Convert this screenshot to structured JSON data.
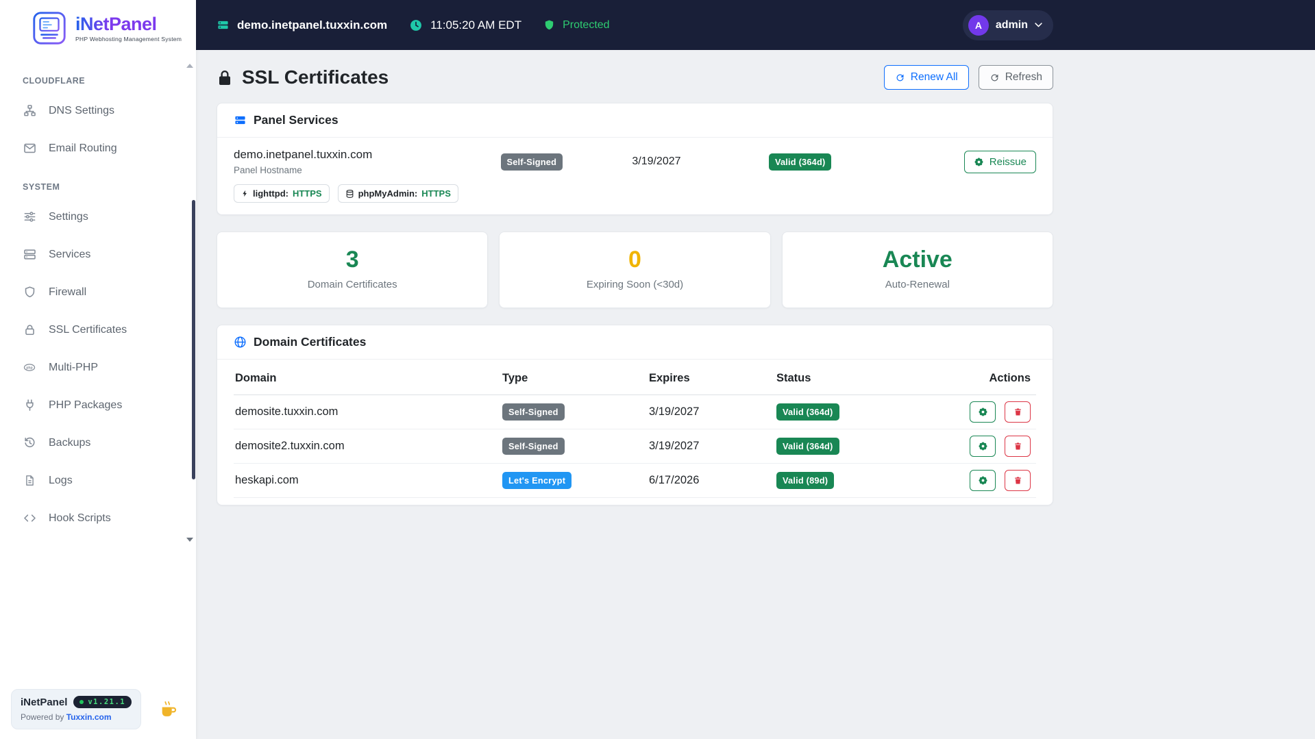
{
  "colors": {
    "topbar_bg": "#191f38",
    "accent_teal": "#1fc8a9",
    "protected_green": "#2ecc71",
    "primary_blue": "#0d6efd",
    "success_green": "#198754",
    "warning_yellow": "#f0b400",
    "danger_red": "#dc3545",
    "lets_encrypt_blue": "#2196f3",
    "avatar_purple": "#7239ea"
  },
  "icons": {
    "logo": "circuit-chip",
    "topbar-host": "server-bars",
    "topbar-time": "clock",
    "topbar-protected": "shield",
    "user-menu": "chevron-down",
    "dns-settings": "sitemap",
    "email-routing": "envelope",
    "settings": "sliders",
    "services": "server-bars",
    "firewall": "shield",
    "ssl-certificates": "lock",
    "multi-php": "php-ellipse",
    "php-packages": "plug",
    "backups": "history-rotate",
    "logs": "file-lines",
    "hook-scripts": "code-brackets",
    "page-title": "lock",
    "renew-all": "rotate-arrows",
    "refresh": "rotate-arrows",
    "panel-services": "server-bars",
    "domain-certificates": "globe",
    "reissue": "certificate-seal",
    "delete": "trash",
    "lighttpd-tag": "bolt",
    "phpmyadmin-tag": "database",
    "donate": "coffee-mug"
  },
  "sidebar": {
    "logo": {
      "name_a": "iNet",
      "name_b": "Panel",
      "subtitle": "PHP Webhosting Management System"
    },
    "sections": [
      {
        "label": "CLOUDFLARE",
        "items": [
          {
            "label": "DNS Settings"
          },
          {
            "label": "Email Routing"
          }
        ]
      },
      {
        "label": "SYSTEM",
        "items": [
          {
            "label": "Settings"
          },
          {
            "label": "Services"
          },
          {
            "label": "Firewall"
          },
          {
            "label": "SSL Certificates"
          },
          {
            "label": "Multi-PHP"
          },
          {
            "label": "PHP Packages"
          },
          {
            "label": "Backups"
          },
          {
            "label": "Logs"
          },
          {
            "label": "Hook Scripts"
          }
        ]
      }
    ],
    "footer": {
      "brand": "iNetPanel",
      "version": "v1.21.1",
      "powered_by": "Powered by",
      "powered_link": "Tuxxin.com"
    }
  },
  "topbar": {
    "hostname": "demo.inetpanel.tuxxin.com",
    "time": "11:05:20 AM EDT",
    "protected_label": "Protected",
    "user": "admin",
    "avatar_initial": "A"
  },
  "page": {
    "title": "SSL Certificates",
    "renew_all_label": "Renew All",
    "refresh_label": "Refresh"
  },
  "panel_services": {
    "title": "Panel Services",
    "hostname": "demo.inetpanel.tuxxin.com",
    "hostname_caption": "Panel Hostname",
    "type_badge": "Self-Signed",
    "expires": "3/19/2027",
    "status_badge": "Valid (364d)",
    "reissue_label": "Reissue",
    "tags": [
      {
        "name": "lighttpd:",
        "value": "HTTPS"
      },
      {
        "name": "phpMyAdmin:",
        "value": "HTTPS"
      }
    ]
  },
  "stats": [
    {
      "value": "3",
      "label": "Domain Certificates"
    },
    {
      "value": "0",
      "label": "Expiring Soon (<30d)"
    },
    {
      "value": "Active",
      "label": "Auto-Renewal"
    }
  ],
  "domain_certificates": {
    "title": "Domain Certificates",
    "columns": [
      "Domain",
      "Type",
      "Expires",
      "Status",
      "Actions"
    ],
    "rows": [
      {
        "domain": "demosite.tuxxin.com",
        "type": "Self-Signed",
        "expires": "3/19/2027",
        "status": "Valid (364d)"
      },
      {
        "domain": "demosite2.tuxxin.com",
        "type": "Self-Signed",
        "expires": "3/19/2027",
        "status": "Valid (364d)"
      },
      {
        "domain": "heskapi.com",
        "type": "Let's Encrypt",
        "expires": "6/17/2026",
        "status": "Valid (89d)"
      }
    ]
  }
}
